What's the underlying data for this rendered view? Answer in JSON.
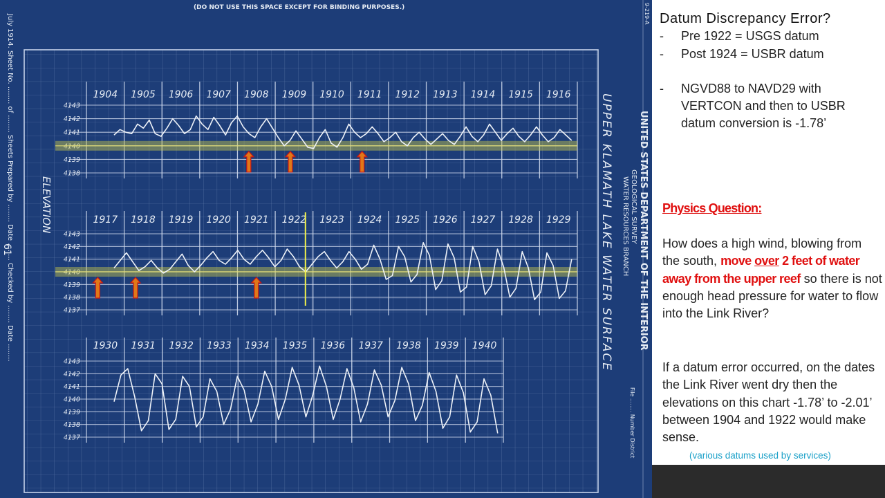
{
  "colors": {
    "blueprint_bg": "#1d3d78",
    "grid_line": "#9db1d6",
    "trace": "#eef2f8",
    "highlight_band": "#c9c84a",
    "arrow_orange": "#e07818",
    "arrow_red": "#c81414",
    "marker_yellow": "#f2f24a",
    "sidebar_red": "#e01010",
    "note_cyan": "#1aa0c8"
  },
  "blueprint": {
    "header_text": "(DO NOT USE THIS SPACE EXCEPT FOR BINDING PURPOSES.)",
    "top_right_code": "9-219-A",
    "vertical_main_title": "UPPER KLAMATH LAKE WATER SURFACE",
    "vertical_agency_1": "UNITED STATES DEPARTMENT OF THE INTERIOR",
    "vertical_agency_2": "GEOLOGICAL SURVEY",
    "vertical_agency_3": "WATER RESOURCES BRANCH",
    "elevation_label": "ELEVATION",
    "left_margin_text": "July 1914.   Sheet No. ........ of ........ Sheets   Prepared by ........   Date ........   Checked by ........   Date ........",
    "page_number": "61",
    "right_margin_text": "File ........  Number  District"
  },
  "chart_data": [
    {
      "type": "line",
      "ylabel": "ELEVATION",
      "years": [
        "1904",
        "1905",
        "1906",
        "1907",
        "1908",
        "1909",
        "1910",
        "1911",
        "1912",
        "1913",
        "1914",
        "1915",
        "1916"
      ],
      "y_ticks": [
        "4143",
        "4142",
        "4141",
        "4140",
        "4139",
        "4138"
      ],
      "ylim": [
        4138,
        4143
      ],
      "highlight_level": 4140,
      "arrows_at_year": [
        1908.3,
        1909.4,
        1911.3
      ],
      "series": [
        {
          "values": [
            4140.8,
            4141.2,
            4141.0,
            4140.9,
            4141.6,
            4141.3,
            4141.9,
            4140.9,
            4140.7,
            4141.3,
            4142.0,
            4141.5,
            4140.9,
            4141.2,
            4142.2,
            4141.6,
            4141.2,
            4142.1,
            4141.5,
            4140.8,
            4141.7,
            4142.2,
            4141.4,
            4140.9,
            4140.6,
            4141.4,
            4142.0,
            4141.3,
            4140.6,
            4140.0,
            4140.4,
            4141.1,
            4140.5,
            4139.9,
            4139.8,
            4140.6,
            4141.2,
            4140.2,
            4139.9,
            4140.6,
            4141.6,
            4141.0,
            4140.6,
            4140.9,
            4141.4,
            4140.9,
            4140.3,
            4140.6,
            4141.0,
            4140.3,
            4140.0,
            4140.6,
            4141.0,
            4140.5,
            4140.1,
            4140.5,
            4140.9,
            4140.4,
            4140.1,
            4140.7,
            4141.4,
            4140.7,
            4140.3,
            4140.8,
            4141.6,
            4141.0,
            4140.4,
            4140.9,
            4141.3,
            4140.7,
            4140.3,
            4140.8,
            4141.4,
            4140.8,
            4140.3,
            4140.6,
            4141.2,
            4140.8,
            4140.4
          ]
        }
      ]
    },
    {
      "type": "line",
      "years": [
        "1917",
        "1918",
        "1919",
        "1920",
        "1921",
        "1922",
        "1923",
        "1924",
        "1925",
        "1926",
        "1927",
        "1928",
        "1929"
      ],
      "y_ticks": [
        "4143",
        "4142",
        "4141",
        "4140",
        "4139",
        "4138",
        "4137"
      ],
      "ylim": [
        4137,
        4143
      ],
      "highlight_level": 4140,
      "arrows_at_year": [
        1917.3,
        1918.3,
        1921.5
      ],
      "marker_year": 1922.8,
      "series": [
        {
          "values": [
            4140.3,
            4140.9,
            4141.5,
            4140.8,
            4140.1,
            4140.4,
            4140.9,
            4140.3,
            4139.9,
            4140.2,
            4140.8,
            4141.4,
            4140.5,
            4140.0,
            4140.5,
            4141.1,
            4141.6,
            4140.9,
            4140.6,
            4141.1,
            4141.7,
            4141.0,
            4140.6,
            4141.2,
            4141.7,
            4141.1,
            4140.4,
            4140.9,
            4141.8,
            4141.2,
            4140.4,
            4140.0,
            4140.6,
            4141.2,
            4141.6,
            4140.9,
            4140.3,
            4140.8,
            4141.6,
            4141.0,
            4140.2,
            4140.6,
            4142.1,
            4141.0,
            4139.4,
            4139.7,
            4142.0,
            4141.2,
            4139.2,
            4139.8,
            4142.3,
            4141.3,
            4138.6,
            4139.3,
            4142.2,
            4141.1,
            4138.4,
            4138.8,
            4142.0,
            4140.8,
            4138.2,
            4138.9,
            4141.8,
            4140.4,
            4138.0,
            4138.7,
            4141.6,
            4140.3,
            4137.8,
            4138.4,
            4141.5,
            4140.5,
            4137.9,
            4138.5,
            4141.0
          ]
        }
      ]
    },
    {
      "type": "line",
      "years": [
        "1930",
        "1931",
        "1932",
        "1933",
        "1934",
        "1935",
        "1936",
        "1937",
        "1938",
        "1939",
        "1940"
      ],
      "y_ticks": [
        "4143",
        "4142",
        "4141",
        "4140",
        "4139",
        "4138",
        "4137"
      ],
      "ylim": [
        4137,
        4143
      ],
      "series": [
        {
          "values": [
            4139.8,
            4141.9,
            4142.4,
            4140.2,
            4137.5,
            4138.3,
            4142.0,
            4141.2,
            4137.6,
            4138.4,
            4141.8,
            4141.0,
            4137.8,
            4138.6,
            4141.6,
            4140.6,
            4138.0,
            4139.2,
            4141.8,
            4140.7,
            4138.2,
            4139.6,
            4142.2,
            4141.0,
            4138.4,
            4140.0,
            4142.5,
            4141.1,
            4138.6,
            4140.3,
            4142.6,
            4141.0,
            4138.4,
            4140.0,
            4142.4,
            4140.9,
            4138.2,
            4139.6,
            4142.3,
            4141.1,
            4138.6,
            4139.9,
            4142.5,
            4141.2,
            4138.3,
            4139.5,
            4142.1,
            4140.6,
            4137.7,
            4138.6,
            4141.9,
            4140.5,
            4137.4,
            4138.2,
            4141.6,
            4140.3,
            4137.3
          ]
        }
      ]
    }
  ],
  "sidebar": {
    "title": "Datum Discrepancy  Error?",
    "bullets": [
      {
        "dash": "-",
        "text": "Pre 1922 = USGS datum"
      },
      {
        "dash": "-",
        "text": "Post 1924 = USBR datum"
      },
      {
        "dash": "-",
        "text": "NGVD88 to NAVD29 with VERTCON and then to USBR datum conversion is -1.78’"
      }
    ],
    "physics_heading": "Physics Question:",
    "q_part1": "How does a high wind, blowing from the south, ",
    "q_red1": "move ",
    "q_red_underline": "over",
    "q_red2": " 2 feet of water away from the upper reef",
    "q_part2": " so there is not enough head pressure for water to flow into the Link River?",
    "datum_paragraph": "If a datum error occurred, on the dates the Link River went dry then the elevations on this chart -1.78’ to -2.01’ between 1904 and 1922 would make sense.",
    "note": "(various datums used by services)"
  }
}
